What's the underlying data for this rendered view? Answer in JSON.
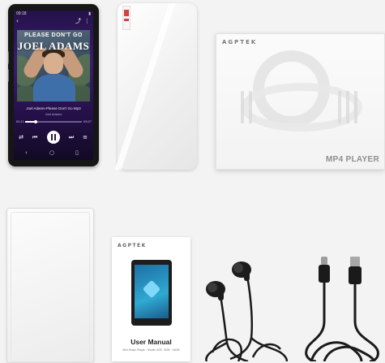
{
  "player": {
    "status_time": "09:18",
    "album_title_line1": "PLEASE DON'T GO",
    "album_title_line2": "JOEL ADAMS",
    "song": "Joel Adams-Please Don't Go Mp3",
    "artist": "Joel Adams",
    "time_elapsed": "00:11",
    "time_total": "03:27",
    "progress": 0.18
  },
  "box": {
    "brand": "AGPTEK",
    "product": "MP4 PLAYER"
  },
  "manual": {
    "brand": "AGPTEK",
    "title": "User Manual",
    "subtitle": "Mini Music Player · Model: A09 · 8GB · 16GB"
  },
  "colors": {
    "screen_purple": "#3a1c6e",
    "background": "#f3f3f3",
    "cable_black": "#1a1a1a"
  }
}
